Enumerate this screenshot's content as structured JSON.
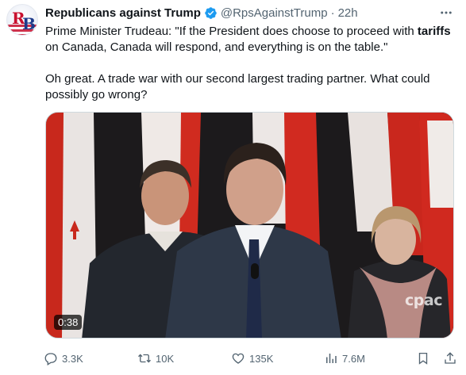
{
  "tweet": {
    "display_name": "Republicans against Trump",
    "handle": "@RpsAgainstTrump",
    "separator": "·",
    "time": "22h",
    "avatar_letters": "RB",
    "text_line1_pre": "Prime Minister Trudeau: \"If the President does choose to proceed with ",
    "text_line1_bold": "tariffs",
    "text_line1_post": " on Canada, Canada will respond, and everything is on the table.\"",
    "text_paragraph2": "Oh great. A trade war with our second largest trading partner. What could possibly go wrong?"
  },
  "media": {
    "duration": "0:38",
    "watermark": "cpac"
  },
  "actions": {
    "replies": "3.3K",
    "reposts": "10K",
    "likes": "135K",
    "views": "7.6M"
  },
  "icons": {
    "verified": "verified-badge-icon",
    "more": "more-icon",
    "reply": "reply-icon",
    "repost": "repost-icon",
    "like": "heart-icon",
    "views": "views-icon",
    "bookmark": "bookmark-icon",
    "share": "share-icon"
  },
  "colors": {
    "verified_blue": "#1d9bf0",
    "secondary_text": "#536471",
    "flag_red": "#d52b1e"
  }
}
